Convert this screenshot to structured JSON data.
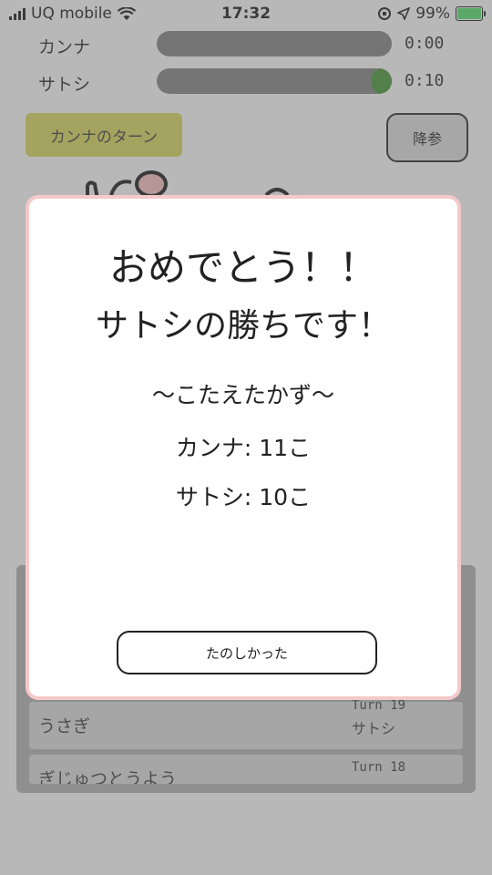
{
  "status_bar": {
    "carrier": "UQ mobile",
    "time": "17:32",
    "battery": "99%"
  },
  "players": [
    {
      "name": "カンナ",
      "time": "0:00",
      "remaining_fraction": 0
    },
    {
      "name": "サトシ",
      "time": "0:10",
      "remaining_fraction": 0.05
    }
  ],
  "turn_label": "カンナのターン",
  "surrender_label": "降参",
  "history": [
    {
      "word": "うさぎ",
      "turn": "Turn 19",
      "player": "サトシ"
    },
    {
      "word": "ぎじゅつとうよう",
      "turn": "Turn 18",
      "player": ""
    }
  ],
  "modal": {
    "title": "おめでとう！！",
    "subtitle": "サトシの勝ちです！",
    "heading": "〜こたえたかず〜",
    "scores": [
      {
        "name": "カンナ",
        "count": "11こ"
      },
      {
        "name": "サトシ",
        "count": "10こ"
      }
    ],
    "button_label": "たのしかった"
  },
  "colors": {
    "modal_border": "#f3c9c9",
    "turn_highlight": "#cfcf55",
    "timer_fill": "#3c8f2d"
  }
}
